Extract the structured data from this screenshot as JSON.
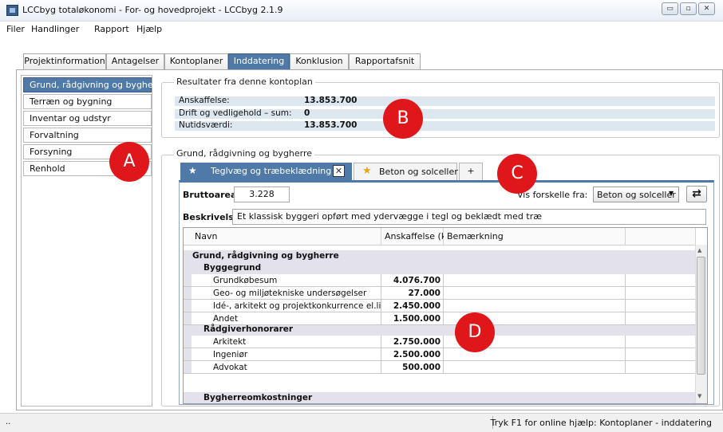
{
  "window": {
    "title": "LCCbyg totaløkonomi - For- og hovedprojekt - LCCbyg 2.1.9",
    "controls": {
      "minimize": "▭",
      "maximize": "▫",
      "close": "✕"
    }
  },
  "menu": [
    "Filer",
    "Handlinger",
    "Rapport",
    "Hjælp"
  ],
  "main_tabs": [
    {
      "label": "Projektinformation",
      "active": false
    },
    {
      "label": "Antagelser",
      "active": false
    },
    {
      "label": "Kontoplaner",
      "active": false
    },
    {
      "label": "Inddatering",
      "active": true
    },
    {
      "label": "Konklusion",
      "active": false
    },
    {
      "label": "Rapportafsnit",
      "active": false
    }
  ],
  "sidebar": {
    "items": [
      {
        "label": "Grund, rådgivning og bygherre",
        "active": true
      },
      {
        "label": "Terræn og bygning",
        "active": false
      },
      {
        "label": "Inventar og udstyr",
        "active": false
      },
      {
        "label": "Forvaltning",
        "active": false
      },
      {
        "label": "Forsyning",
        "active": false
      },
      {
        "label": "Renhold",
        "active": false
      }
    ]
  },
  "results": {
    "caption": "Resultater fra denne kontoplan",
    "rows": [
      {
        "label": "Anskaffelse:",
        "value": "13.853.700"
      },
      {
        "label": "Drift og vedligehold – sum:",
        "value": "0"
      },
      {
        "label": "Nutidsværdi:",
        "value": "13.853.700"
      }
    ]
  },
  "section": {
    "caption": "Grund, rådgivning og bygherre",
    "variant_tabs": [
      {
        "label": "Teglvæg og træbeklædning",
        "active": true
      },
      {
        "label": "Beton og solceller",
        "active": false
      }
    ],
    "add_tab": "+",
    "bruttoareal_label": "Bruttoareal",
    "bruttoareal_value": "3.228",
    "compare_label": "Vis forskelle fra:",
    "compare_value": "Beton og solceller",
    "beskrivelse_label": "Beskrivelse",
    "beskrivelse_value": "Et klassisk byggeri opført med ydervægge i tegl og beklædt med træ"
  },
  "table": {
    "columns": [
      "Navn",
      "Anskaffelse (kr)",
      "Bemærkning"
    ],
    "rows": [
      {
        "kind": "group",
        "name": "Grund, rådgivning og bygherre",
        "value": ""
      },
      {
        "kind": "subgroup",
        "name": "Byggegrund",
        "value": ""
      },
      {
        "kind": "item",
        "name": "Grundkøbesum",
        "value": "4.076.700"
      },
      {
        "kind": "item",
        "name": "Geo- og miljøtekniske undersøgelser",
        "value": "27.000"
      },
      {
        "kind": "item",
        "name": "Idé-, arkitekt og projektkonkurrence el.lign",
        "value": "2.450.000"
      },
      {
        "kind": "item",
        "name": "Andet",
        "value": "1.500.000"
      },
      {
        "kind": "subgroup",
        "name": "Rådgiverhonorarer",
        "value": ""
      },
      {
        "kind": "item",
        "name": "Arkitekt",
        "value": "2.750.000"
      },
      {
        "kind": "item",
        "name": "Ingeniør",
        "value": "2.500.000"
      },
      {
        "kind": "item",
        "name": "Advokat",
        "value": "500.000"
      },
      {
        "kind": "subgroup",
        "name": "Bygherreomkostninger",
        "value": ""
      }
    ]
  },
  "status": {
    "left": "..",
    "text": "Tryk F1 for online hjælp: Kontoplaner - inddatering"
  },
  "callouts": [
    "A",
    "B",
    "C",
    "D"
  ],
  "colors": {
    "accent": "#4f79a6",
    "group_row": "#e3e1ea",
    "result_row": "#dde7f0",
    "callout": "#e0171a"
  }
}
